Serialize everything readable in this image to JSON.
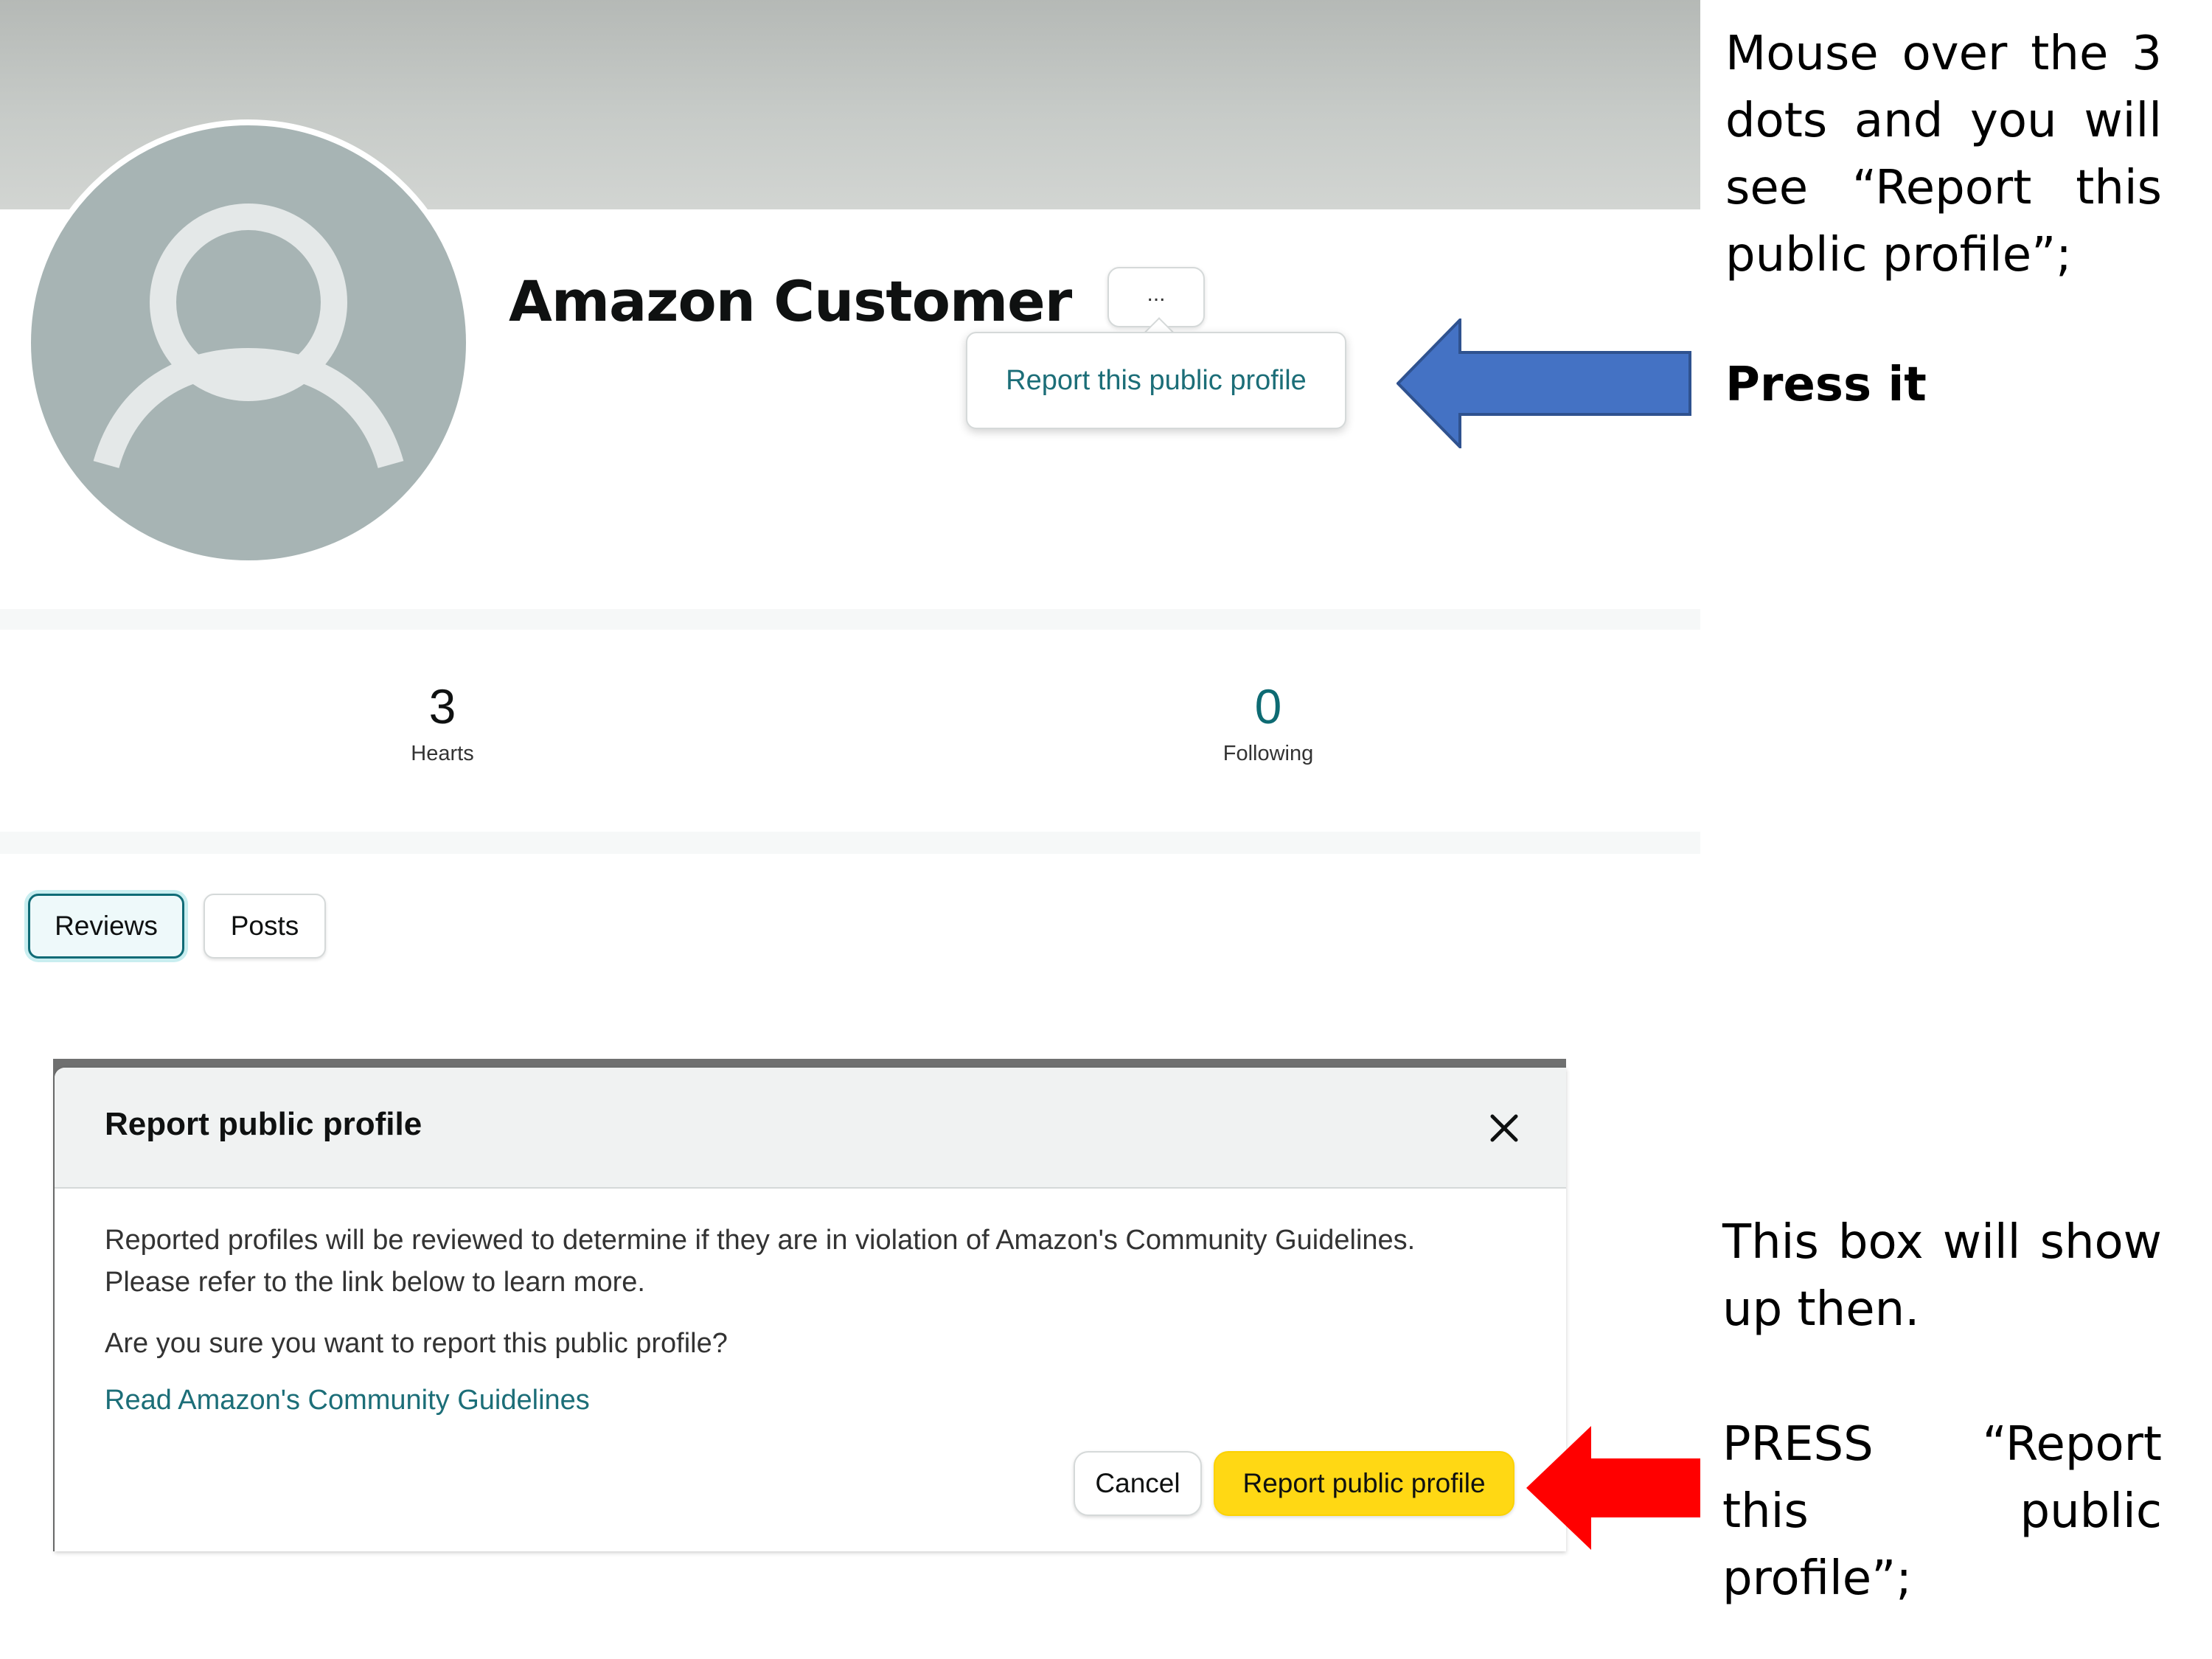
{
  "profile": {
    "name": "Amazon Customer",
    "more_button_label": "...",
    "popover_link": "Report this public profile",
    "stats": [
      {
        "value": "3",
        "label": "Hearts"
      },
      {
        "value": "0",
        "label": "Following"
      }
    ],
    "tabs": [
      {
        "label": "Reviews",
        "selected": true
      },
      {
        "label": "Posts",
        "selected": false
      }
    ]
  },
  "modal": {
    "title": "Report public profile",
    "paragraph_1": "Reported profiles will be reviewed to determine if they are in violation of Amazon's Community Guidelines. Please refer to the link below to learn more.",
    "paragraph_2": "Are you sure you want to report this public profile?",
    "guidelines_link": "Read Amazon's Community Guidelines",
    "cancel_label": "Cancel",
    "report_label": "Report public profile"
  },
  "captions": {
    "step1": "Mouse over the 3 dots and you will see “Report this public profile”;",
    "step1_action": "Press it",
    "step2": "This box will show up then.",
    "step2_action": "PRESS “Report this public profile”;"
  },
  "colors": {
    "accent_teal": "#1c6e78",
    "primary_button": "#ffd814",
    "blue_arrow": "#4472c4",
    "red_arrow": "#ff0000"
  },
  "icons": {
    "avatar": "user-silhouette-icon",
    "close": "close-icon",
    "blue_arrow": "left-arrow-icon",
    "red_arrow": "left-arrow-icon"
  }
}
